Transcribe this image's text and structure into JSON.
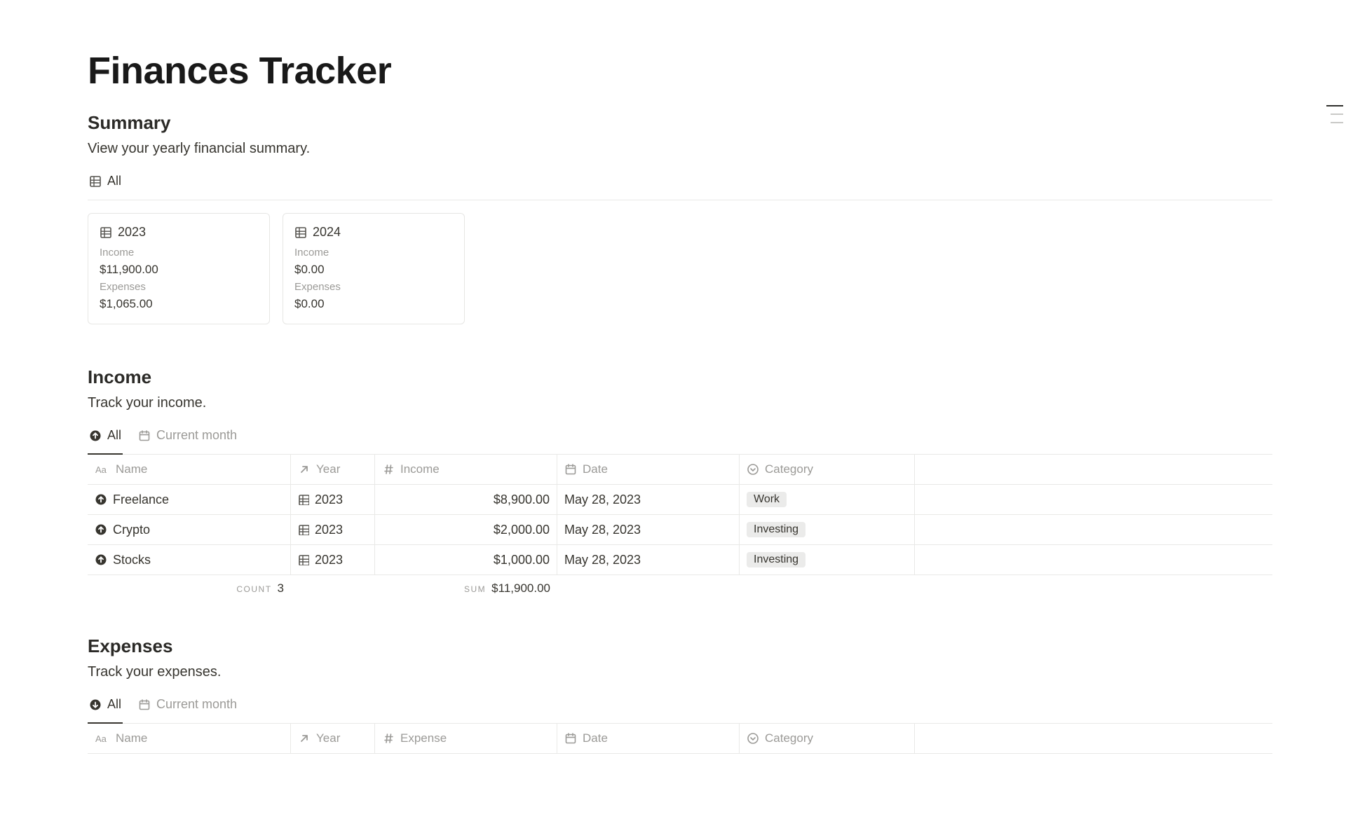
{
  "page_title": "Finances Tracker",
  "summary": {
    "heading": "Summary",
    "description": "View your yearly financial summary.",
    "view_tab_label": "All",
    "cards": [
      {
        "year": "2023",
        "income_label": "Income",
        "income_value": "$11,900.00",
        "expenses_label": "Expenses",
        "expenses_value": "$1,065.00"
      },
      {
        "year": "2024",
        "income_label": "Income",
        "income_value": "$0.00",
        "expenses_label": "Expenses",
        "expenses_value": "$0.00"
      }
    ]
  },
  "income": {
    "heading": "Income",
    "description": "Track your income.",
    "views": {
      "all": "All",
      "current_month": "Current month"
    },
    "columns": {
      "name": "Name",
      "year": "Year",
      "income": "Income",
      "date": "Date",
      "category": "Category"
    },
    "rows": [
      {
        "name": "Freelance",
        "year": "2023",
        "income": "$8,900.00",
        "date": "May 28, 2023",
        "category": "Work"
      },
      {
        "name": "Crypto",
        "year": "2023",
        "income": "$2,000.00",
        "date": "May 28, 2023",
        "category": "Investing"
      },
      {
        "name": "Stocks",
        "year": "2023",
        "income": "$1,000.00",
        "date": "May 28, 2023",
        "category": "Investing"
      }
    ],
    "aggregates": {
      "count_label": "COUNT",
      "count_value": "3",
      "sum_label": "SUM",
      "sum_value": "$11,900.00"
    }
  },
  "expenses": {
    "heading": "Expenses",
    "description": "Track your expenses.",
    "views": {
      "all": "All",
      "current_month": "Current month"
    },
    "columns": {
      "name": "Name",
      "year": "Year",
      "expense": "Expense",
      "date": "Date",
      "category": "Category"
    }
  }
}
